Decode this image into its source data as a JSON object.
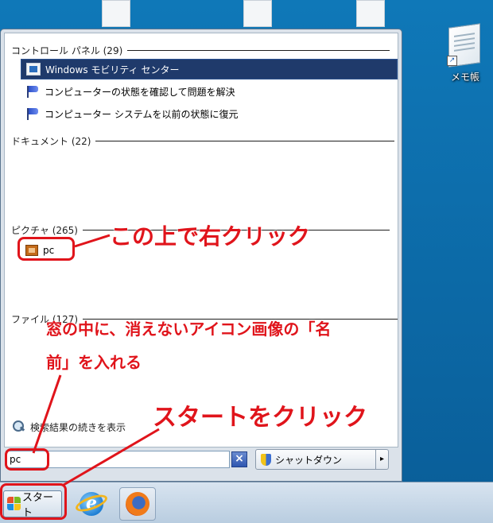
{
  "desktop": {
    "notepad_label": "メモ帳"
  },
  "start_menu": {
    "groups": {
      "control_panel": "コントロール パネル (29)",
      "documents": "ドキュメント (22)",
      "pictures": "ピクチャ (265)",
      "files": "ファイル (127)"
    },
    "control_panel_results": [
      {
        "label": "Windows モビリティ センター",
        "icon": "mobility-center-icon",
        "selected": true
      },
      {
        "label": "コンピューターの状態を確認して問題を解決",
        "icon": "action-center-flag-icon"
      },
      {
        "label": "コンピューター システムを以前の状態に復元",
        "icon": "action-center-flag-icon"
      }
    ],
    "picture_results": [
      {
        "label": "pc",
        "icon": "picture-file-icon"
      }
    ],
    "see_more": "検索結果の続きを表示",
    "search": {
      "value": "pc"
    },
    "clear_button": "×",
    "shutdown_label": "シャットダウン",
    "shutdown_arrow": "▸"
  },
  "taskbar": {
    "start_label": "スタート"
  },
  "annotations": {
    "right_click": "この上で右クリック",
    "instruction_line1": "窓の中に、消えないアイコン画像の「名",
    "instruction_line2": "前」を入れる",
    "start_click": "スタートをクリック"
  },
  "colors": {
    "accent_selected": "#1f3a6b",
    "annotation_red": "#e0141b",
    "desktop_blue": "#0e6aa8"
  }
}
